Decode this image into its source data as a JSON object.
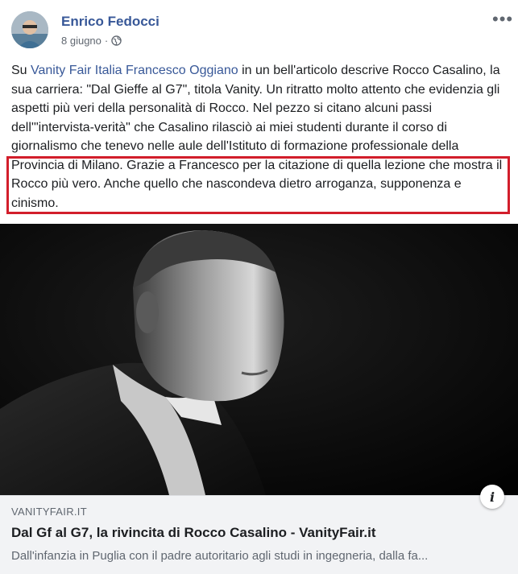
{
  "post": {
    "author": "Enrico Fedocci",
    "date": "8 giugno",
    "separator": "·",
    "privacy_icon": "globe-icon",
    "more_label": "•••",
    "text": {
      "t1": "Su ",
      "link1": "Vanity Fair Italia",
      "t2": " ",
      "link2": "Francesco Oggiano",
      "t3": " in un bell'articolo descrive Rocco Casalino, la sua carriera: \"Dal Gieffe al G7\", titola Vanity. Un ritratto molto attento che evidenzia gli aspetti più veri della personalità di Rocco. Nel pezzo si citano alcuni passi dell'\"intervista-verità\" che Casalino rilasciò ai miei studenti durante il corso di giornalismo che tenevo nelle aule dell'Istituto di formazione professionale della Provincia di Milano. Grazie a Francesco per la citazione di quella lezione che mostra il Rocco più vero. Anche quello che nascondeva dietro arroganza, supponenza e cinismo."
    }
  },
  "link_preview": {
    "domain": "VANITYFAIR.IT",
    "title": "Dal Gf al G7, la rivincita di Rocco Casalino - VanityFair.it",
    "description": "Dall'infanzia in Puglia con il padre autoritario agli studi in ingegneria, dalla fa...",
    "info_label": "i"
  },
  "colors": {
    "link": "#385898",
    "highlight_border": "#d21e2b",
    "card_bg": "#f2f3f5"
  }
}
